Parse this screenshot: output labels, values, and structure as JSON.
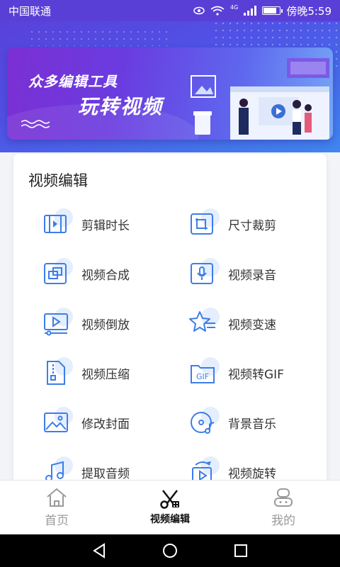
{
  "status_bar": {
    "carrier": "中国联通",
    "network": "4G",
    "time": "傍晚5:59",
    "battery_level": 0.8,
    "icons": [
      "eye-icon",
      "wifi-icon",
      "signal-icon",
      "battery-icon"
    ]
  },
  "banner": {
    "subtitle": "众多编辑工具",
    "title": "玩转视频"
  },
  "card": {
    "title": "视频编辑",
    "tools": [
      {
        "label": "剪辑时长",
        "icon": "trim-icon"
      },
      {
        "label": "尺寸裁剪",
        "icon": "crop-icon"
      },
      {
        "label": "视频合成",
        "icon": "merge-icon"
      },
      {
        "label": "视频录音",
        "icon": "microphone-icon"
      },
      {
        "label": "视频倒放",
        "icon": "reverse-play-icon"
      },
      {
        "label": "视频变速",
        "icon": "speed-icon"
      },
      {
        "label": "视频压缩",
        "icon": "compress-icon"
      },
      {
        "label": "视频转GIF",
        "icon": "gif-icon"
      },
      {
        "label": "修改封面",
        "icon": "cover-image-icon"
      },
      {
        "label": "背景音乐",
        "icon": "music-disc-icon"
      },
      {
        "label": "提取音频",
        "icon": "audio-extract-icon"
      },
      {
        "label": "视频旋转",
        "icon": "rotate-icon"
      }
    ]
  },
  "bottom_nav": {
    "items": [
      {
        "label": "首页",
        "icon": "home-icon",
        "active": false
      },
      {
        "label": "视频编辑",
        "icon": "scissors-film-icon",
        "active": true
      },
      {
        "label": "我的",
        "icon": "profile-icon",
        "active": false
      }
    ]
  },
  "system_nav": {
    "icons": [
      "back-icon",
      "home-circle-icon",
      "recents-icon"
    ]
  },
  "colors": {
    "accent": "#3d7de9",
    "header_start": "#5b3ed8",
    "header_end": "#3f86ef",
    "icon_blob": "#e4eefc"
  }
}
